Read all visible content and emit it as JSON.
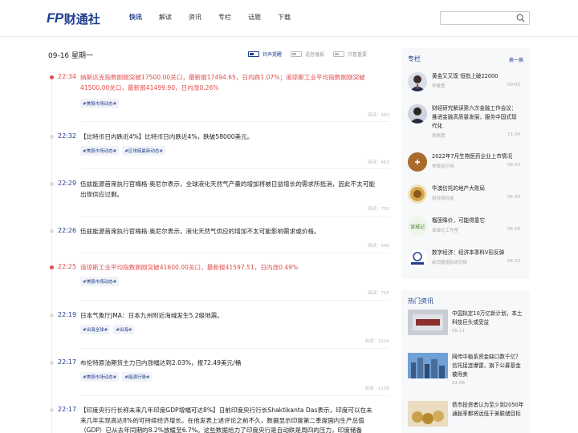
{
  "header": {
    "logo_fp": "FP",
    "logo_cn": "财通社",
    "nav": [
      "快讯",
      "解读",
      "资讯",
      "专栏",
      "话题",
      "下载"
    ],
    "search_placeholder": ""
  },
  "feed": {
    "date": "09-16 星期一",
    "toggles": [
      "铃声提醒",
      "语音播报",
      "只看重要"
    ],
    "items": [
      {
        "time": "22:34",
        "red": true,
        "text": "纳斯达克指数刚刚突破17500.00关口，最新报17494.65，日内跌1.07%；道琼斯工业平均指数刚刚突破41500.00关口，最新报41499.90，日内涨0.26%",
        "tags": [
          "#美股市场动态#"
        ],
        "reads": "阅读：493"
      },
      {
        "time": "22:32",
        "red": false,
        "text": "【比特币日内跌近4%】比特币日内跌近4%，跌破58000美元。",
        "tags": [
          "#美股市场动态#",
          "#区块链最新动态#"
        ],
        "reads": "阅读：463"
      },
      {
        "time": "22:29",
        "red": false,
        "text": "伍兹能源首席执行官梅格·奥尼尔表示，全球液化天然气产量的增加将被日益增长的需求所抵消，因此不太可能出现供应过剩。",
        "tags": [],
        "reads": "阅读：750"
      },
      {
        "time": "22:26",
        "red": false,
        "text": "伍兹能源首席执行官梅格·奥尼尔表示，液化天然气供应的增加不太可能影响需求或价格。",
        "tags": [],
        "reads": "阅读：640"
      },
      {
        "time": "22:25",
        "red": true,
        "text": "道琼斯工业平均指数刚刚突破41600.00关口，最新报41597.51，日内涨0.49%",
        "tags": [
          "#美股市场动态#"
        ],
        "reads": "阅读：755"
      },
      {
        "time": "22:19",
        "red": false,
        "text": "日本气象厅JMA：日本九州附近海域发生5.2级地震。",
        "tags": [
          "#出海全球#",
          "#出海#"
        ],
        "reads": "阅读：1224"
      },
      {
        "time": "22:17",
        "red": false,
        "text": "布伦特原油期货主力日内涨幅达到2.03%，报72.49美元/桶",
        "tags": [
          "#美股市场动态#",
          "#能源行情#"
        ],
        "reads": "阅读：1156"
      },
      {
        "time": "22:17",
        "red": false,
        "text": "【印度央行行长称未来几年印度GDP增幅可达8%】日前印度央行行长Shaktikanta Das表示，印度可以在未来几年实现高达8%的可持续经济增长。在他发表上述评论之前不久，数据显示印度第二季度国内生产总值（GDP）已从去年同期的8.2%放缓至6.7%。这些数据给力了印度央行是自动跌是周四的压力，印度储备",
        "tags": [],
        "reads": ""
      }
    ]
  },
  "columns": {
    "title": "专栏",
    "more": "换一换",
    "items": [
      {
        "title": "黄金又又现 恒指上破22000",
        "author": "李敬勇",
        "date": "09-05"
      },
      {
        "title": "财经研究解读第六次金融工作会议：推进金融高质量发展，服务中国式现代化",
        "author": "邢振勇",
        "date": "11-04"
      },
      {
        "title": "2022年7月生物医药企业上市情况",
        "author": "美股医疗网",
        "date": "08-03"
      },
      {
        "title": "华澳信托的地产大败局",
        "author": "财经政经者",
        "date": "05-30"
      },
      {
        "title": "榴莲降价，可能得靠它",
        "author": "读城记工作室",
        "date": "05-18"
      },
      {
        "title": "数字经济：经济本季料V形反弹",
        "author": "新消费国际研究院",
        "date": "04-23"
      }
    ],
    "avatar_labels": [
      "读城记"
    ]
  },
  "hot": {
    "title": "热门资讯",
    "items": [
      {
        "title": "中国拟定10万亿新计划，本土科技巨头或受益",
        "date": "05-11"
      },
      {
        "title": "网传中植系资金缺口数千亿？信托接连爆雷，旗下公募基金被甩卖",
        "date": "02-06"
      },
      {
        "title": "债市投资者认为至少到2050年 通胀率都将远低于美联储目标",
        "date": "02-03"
      }
    ]
  }
}
